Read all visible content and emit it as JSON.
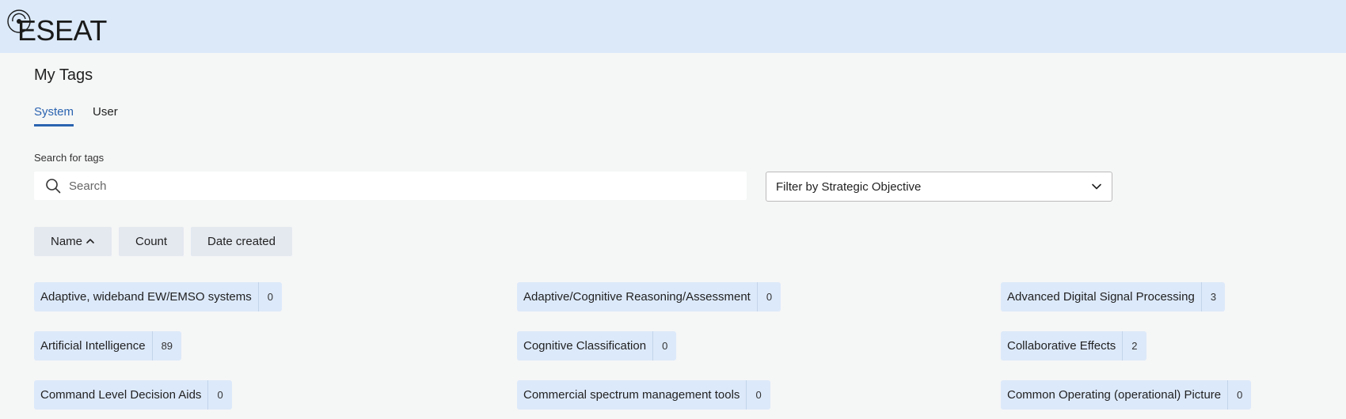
{
  "app": {
    "logo_text": "ESEAT"
  },
  "page": {
    "title": "My Tags"
  },
  "tabs": [
    {
      "label": "System",
      "active": true
    },
    {
      "label": "User",
      "active": false
    }
  ],
  "search": {
    "label": "Search for tags",
    "placeholder": "Search",
    "value": ""
  },
  "filter": {
    "label": "Filter by Strategic Objective"
  },
  "sort": {
    "name_label": "Name",
    "name_direction": "ascending",
    "count_label": "Count",
    "date_label": "Date created"
  },
  "tags": [
    {
      "name": "Adaptive, wideband EW/EMSO systems",
      "count": "0"
    },
    {
      "name": "Adaptive/Cognitive Reasoning/Assessment",
      "count": "0"
    },
    {
      "name": "Advanced Digital Signal Processing",
      "count": "3"
    },
    {
      "name": "Artificial Intelligence",
      "count": "89"
    },
    {
      "name": "Cognitive Classification",
      "count": "0"
    },
    {
      "name": "Collaborative Effects",
      "count": "2"
    },
    {
      "name": "Command Level Decision Aids",
      "count": "0"
    },
    {
      "name": "Commercial spectrum management tools",
      "count": "0"
    },
    {
      "name": "Common Operating (operational) Picture",
      "count": "0"
    }
  ],
  "colors": {
    "accent": "#2a64b0",
    "header_bg": "#dbe9f9",
    "tag_bg": "#dce9fa"
  }
}
